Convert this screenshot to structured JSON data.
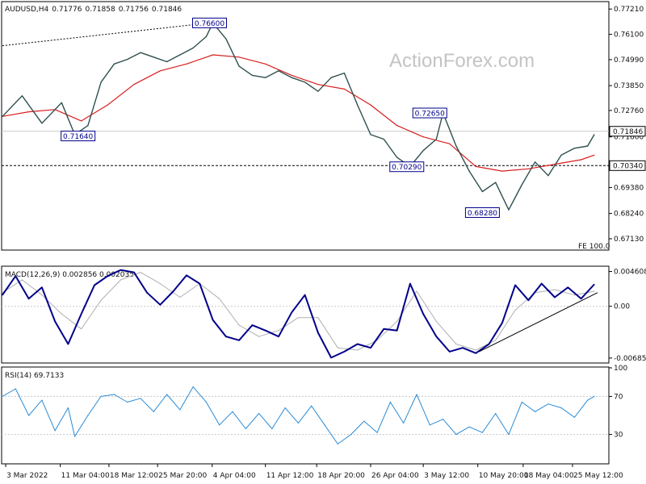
{
  "chart_data": {
    "type": "line",
    "header": {
      "symbol": "AUDUSD,H4",
      "open": "0.71776",
      "high": "0.71858",
      "low": "0.71756",
      "close": "0.71846"
    },
    "watermark": "ActionForex.com",
    "price_axis": {
      "ylim": [
        0.6667,
        0.775
      ],
      "ticks": [
        "0.77210",
        "0.76100",
        "0.74990",
        "0.73850",
        "0.72760",
        "0.71600",
        "0.70340",
        "0.69380",
        "0.68240",
        "0.67130"
      ],
      "tick_values": [
        0.7721,
        0.761,
        0.7499,
        0.7385,
        0.7276,
        0.716,
        0.7034,
        0.6938,
        0.6824,
        0.6713
      ],
      "current_price": "0.71846",
      "current_price_value": 0.71846,
      "support_line": "0.70340",
      "support_line_value": 0.7034
    },
    "x_labels": [
      "3 Mar 2022",
      "11 Mar 04:00",
      "18 Mar 12:00",
      "25 Mar 20:00",
      "4 Apr 04:00",
      "11 Apr 12:00",
      "18 Apr 20:00",
      "26 Apr 04:00",
      "3 May 12:00",
      "10 May 20:00",
      "18 May 04:00",
      "25 May 12:00"
    ],
    "x_label_positions": [
      0.5,
      8.8,
      16.2,
      23.6,
      31.9,
      40.0,
      47.8,
      56.0,
      64.0,
      72.3,
      79.2,
      86.7
    ],
    "x_range": [
      0,
      91
    ],
    "price_labels": [
      {
        "text": "0.76600",
        "x": 31.5,
        "value": 0.766
      },
      {
        "text": "0.71640",
        "x": 11.5,
        "value": 0.7164
      },
      {
        "text": "0.72650",
        "x": 65.0,
        "value": 0.7265
      },
      {
        "text": "0.70290",
        "x": 61.5,
        "value": 0.7029
      },
      {
        "text": "0.68280",
        "x": 73.0,
        "value": 0.6828
      }
    ],
    "fib_label": "FE 100.0",
    "trendline": {
      "points": [
        [
          0,
          0.756
        ],
        [
          31.5,
          0.766
        ]
      ]
    },
    "price_series": {
      "name": "AUDUSD",
      "x": [
        0,
        3,
        6,
        9,
        11,
        13,
        15,
        17,
        19,
        21,
        23,
        25,
        27,
        29,
        31,
        32,
        34,
        36,
        38,
        40,
        42,
        44,
        46,
        48,
        50,
        52,
        54,
        56,
        58,
        60,
        62,
        64,
        66,
        67,
        69,
        71,
        73,
        75,
        77,
        79,
        81,
        83,
        85,
        87,
        89,
        90
      ],
      "values": [
        0.725,
        0.734,
        0.722,
        0.731,
        0.717,
        0.721,
        0.74,
        0.748,
        0.75,
        0.753,
        0.751,
        0.749,
        0.752,
        0.755,
        0.76,
        0.766,
        0.759,
        0.747,
        0.743,
        0.742,
        0.745,
        0.742,
        0.74,
        0.736,
        0.742,
        0.744,
        0.73,
        0.717,
        0.715,
        0.707,
        0.703,
        0.71,
        0.715,
        0.7265,
        0.712,
        0.701,
        0.692,
        0.696,
        0.684,
        0.695,
        0.705,
        0.699,
        0.708,
        0.711,
        0.712,
        0.717
      ]
    },
    "ma_series": {
      "name": "MA",
      "x": [
        0,
        4,
        8,
        12,
        16,
        20,
        24,
        28,
        32,
        36,
        40,
        44,
        48,
        52,
        56,
        60,
        64,
        68,
        72,
        76,
        80,
        84,
        88,
        90
      ],
      "values": [
        0.725,
        0.727,
        0.728,
        0.723,
        0.73,
        0.739,
        0.745,
        0.748,
        0.752,
        0.751,
        0.748,
        0.743,
        0.739,
        0.737,
        0.73,
        0.721,
        0.716,
        0.713,
        0.703,
        0.701,
        0.702,
        0.704,
        0.706,
        0.708
      ]
    },
    "macd": {
      "label": "MACD(12,26,9) 0.002856 0.002035",
      "ticks": [
        "0.004608",
        "0.00",
        "-0.006853"
      ],
      "tick_values": [
        0.004608,
        0.0,
        -0.006853
      ],
      "ylim": [
        -0.0074,
        0.0052
      ],
      "macd_series": {
        "x": [
          0,
          2,
          4,
          6,
          8,
          10,
          12,
          14,
          16,
          18,
          20,
          22,
          24,
          26,
          28,
          30,
          32,
          34,
          36,
          38,
          40,
          42,
          44,
          46,
          48,
          50,
          52,
          54,
          56,
          58,
          60,
          62,
          64,
          66,
          68,
          70,
          72,
          74,
          76,
          78,
          80,
          82,
          84,
          86,
          88,
          90
        ],
        "values": [
          0.0015,
          0.004,
          0.001,
          0.0025,
          -0.002,
          -0.005,
          -0.001,
          0.0028,
          0.004,
          0.0048,
          0.0045,
          0.0018,
          0.0002,
          0.002,
          0.0041,
          0.003,
          -0.0018,
          -0.004,
          -0.0045,
          -0.0025,
          -0.0032,
          -0.004,
          -0.0008,
          0.0015,
          -0.0035,
          -0.0068,
          -0.006,
          -0.005,
          -0.0055,
          -0.003,
          -0.0032,
          0.003,
          -0.001,
          -0.004,
          -0.006,
          -0.0055,
          -0.0062,
          -0.005,
          -0.0022,
          0.0028,
          0.0008,
          0.003,
          0.0012,
          0.0025,
          0.001,
          0.0029
        ]
      },
      "signal_series": {
        "x": [
          0,
          3,
          6,
          9,
          12,
          15,
          18,
          21,
          24,
          27,
          30,
          33,
          36,
          39,
          42,
          45,
          48,
          51,
          54,
          57,
          60,
          63,
          66,
          69,
          72,
          75,
          78,
          81,
          84,
          87,
          90
        ],
        "values": [
          0.0018,
          0.0035,
          0.0015,
          -0.001,
          -0.003,
          0.0008,
          0.0035,
          0.0045,
          0.003,
          0.0012,
          0.003,
          0.001,
          -0.0025,
          -0.004,
          -0.0032,
          -0.0015,
          -0.0015,
          -0.0055,
          -0.0058,
          -0.0045,
          -0.002,
          0.002,
          -0.002,
          -0.005,
          -0.0058,
          -0.0045,
          -0.0005,
          0.0018,
          0.0022,
          0.0015,
          0.002
        ]
      },
      "trendline": {
        "points": [
          [
            72.5,
            -0.006
          ],
          [
            90.5,
            0.0018
          ]
        ]
      }
    },
    "rsi": {
      "label": "RSI(14) 69.7133",
      "ticks": [
        "100",
        "70",
        "30"
      ],
      "tick_values": [
        100,
        70,
        30
      ],
      "ylim": [
        0,
        100
      ],
      "levels": [
        70,
        30
      ],
      "series": {
        "x": [
          0,
          2,
          4,
          6,
          8,
          10,
          11,
          13,
          15,
          17,
          19,
          21,
          23,
          25,
          27,
          29,
          31,
          33,
          35,
          37,
          39,
          41,
          43,
          45,
          47,
          49,
          51,
          53,
          55,
          57,
          59,
          61,
          63,
          65,
          67,
          69,
          71,
          73,
          75,
          77,
          79,
          81,
          83,
          85,
          87,
          89,
          90
        ],
        "values": [
          70,
          78,
          50,
          66,
          34,
          58,
          28,
          50,
          70,
          72,
          64,
          68,
          54,
          72,
          56,
          80,
          64,
          40,
          54,
          36,
          52,
          36,
          58,
          42,
          60,
          40,
          20,
          30,
          44,
          32,
          64,
          42,
          72,
          40,
          46,
          30,
          38,
          32,
          52,
          30,
          64,
          54,
          62,
          58,
          48,
          66,
          70
        ]
      }
    },
    "colors": {
      "price": "#2f4f4f",
      "ma": "#d81e1e",
      "macd": "#00008b",
      "signal": "#b0b0b0",
      "rsi": "#2a8bd6",
      "label_border": "#00008b",
      "label_text": "#00008b",
      "grid": "#c8c8c8",
      "axis": "#000000"
    }
  }
}
